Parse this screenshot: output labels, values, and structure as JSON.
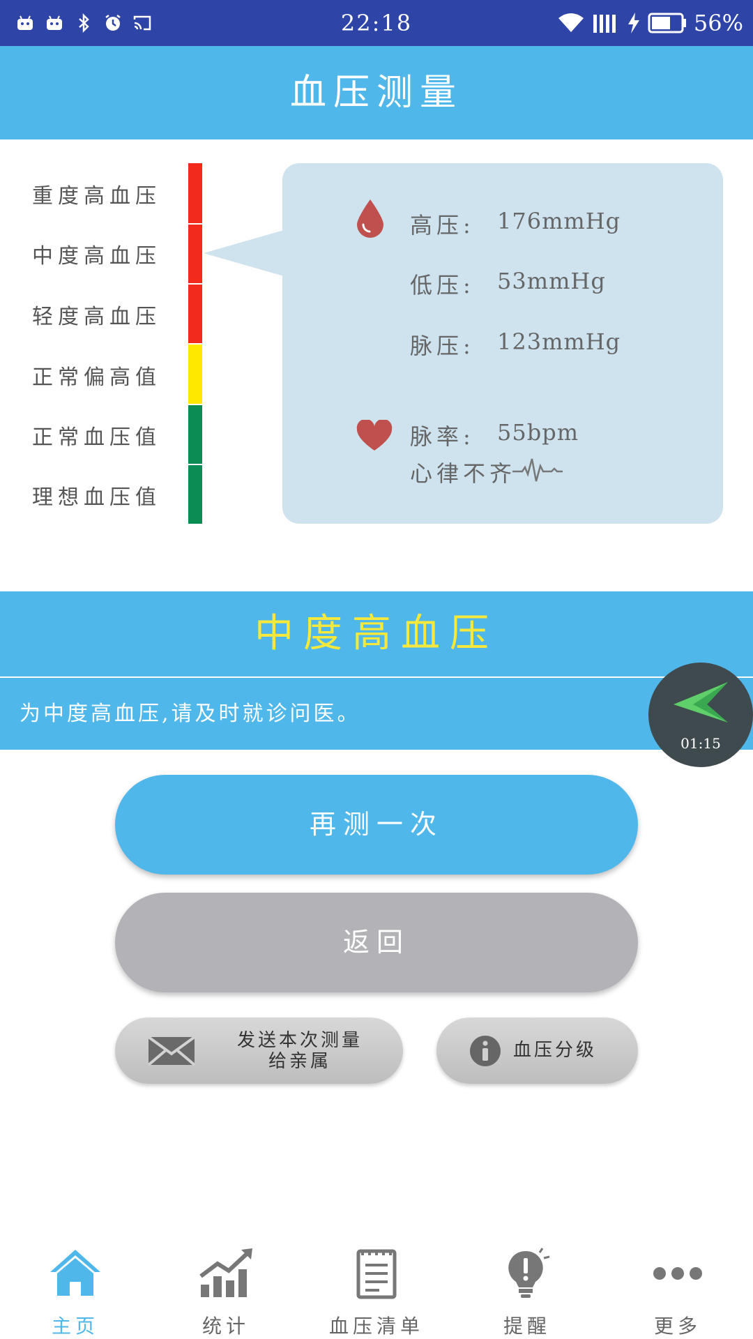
{
  "status_bar": {
    "time": "22:18",
    "battery_percent": "56%"
  },
  "header": {
    "title": "血压测量"
  },
  "scale": {
    "levels": [
      {
        "label": "重度高血压",
        "color": "#f22a1c"
      },
      {
        "label": "中度高血压",
        "color": "#f22a1c"
      },
      {
        "label": "轻度高血压",
        "color": "#f22a1c"
      },
      {
        "label": "正常偏高值",
        "color": "#ffe800"
      },
      {
        "label": "正常血压值",
        "color": "#0a8c54"
      },
      {
        "label": "理想血压值",
        "color": "#0a8c54"
      }
    ],
    "pointer_level": "中度高血压"
  },
  "readings": {
    "systolic_label": "高压:",
    "systolic_value": "176mmHg",
    "diastolic_label": "低压:",
    "diastolic_value": "53mmHg",
    "pulse_pressure_label": "脉压:",
    "pulse_pressure_value": "123mmHg",
    "pulse_rate_label": "脉率:",
    "pulse_rate_value": "55bpm",
    "arrhythmia_text": "心律不齐"
  },
  "result": {
    "level_title": "中度高血压",
    "advice": "为中度高血压,请及时就诊问医。"
  },
  "floating_widget": {
    "time": "01:15"
  },
  "buttons": {
    "measure_again": "再测一次",
    "back": "返回",
    "send_line1": "发送本次测量",
    "send_line2": "给亲属",
    "grade": "血压分级"
  },
  "bottom_nav": {
    "items": [
      {
        "label": "主页",
        "icon": "home-icon",
        "active": true
      },
      {
        "label": "统计",
        "icon": "chart-icon",
        "active": false
      },
      {
        "label": "血压清单",
        "icon": "list-icon",
        "active": false
      },
      {
        "label": "提醒",
        "icon": "reminder-icon",
        "active": false
      },
      {
        "label": "更多",
        "icon": "more-icon",
        "active": false
      }
    ]
  },
  "colors": {
    "status_bar": "#2e44a6",
    "primary": "#4fb7ea",
    "bubble": "#cfe3ee",
    "level_title_text": "#f6e93b",
    "icon_red": "#c0504d"
  }
}
